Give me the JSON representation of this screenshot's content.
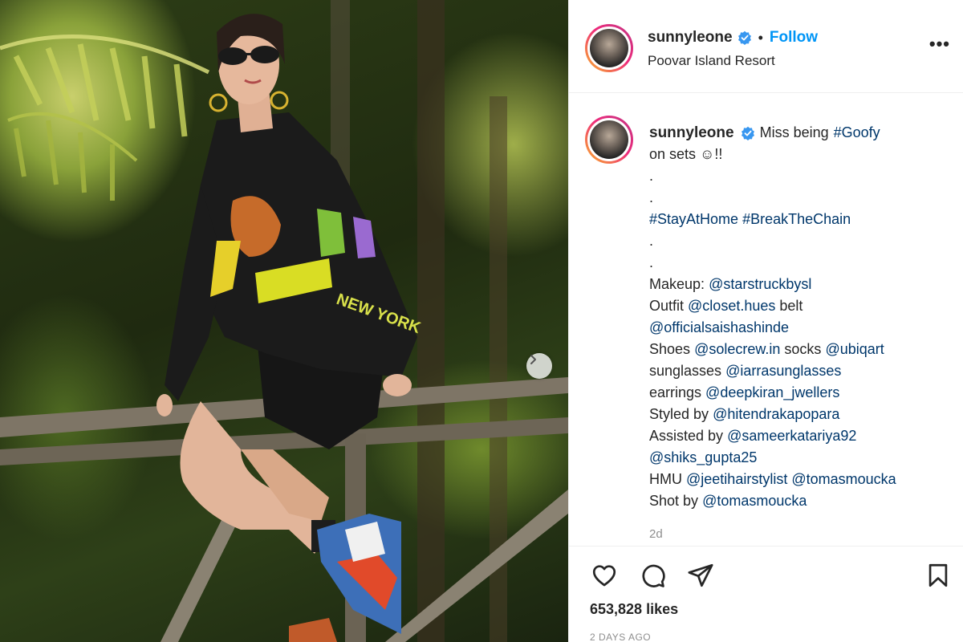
{
  "post": {
    "username": "sunnyleone",
    "follow_label": "Follow",
    "separator": "•",
    "location": "Poovar Island Resort",
    "more_label": "•••"
  },
  "caption": {
    "username": "sunnyleone",
    "text_before": "Miss being",
    "hashtag_goofy": "#Goofy",
    "text_after": "on sets ☺!!",
    "dot": ".",
    "hashtag_stay": "#StayAtHome",
    "hashtag_break": "#BreakTheChain",
    "makeup_label": "Makeup:",
    "makeup_handle": "@starstruckbysl",
    "outfit_label": "Outfit",
    "outfit_handle": "@closet.hues",
    "belt_label": "belt",
    "belt_handle": "@officialsaishashinde",
    "shoes_label": "Shoes",
    "shoes_handle": "@solecrew.in",
    "socks_label": "socks",
    "socks_handle": "@ubiqart",
    "sunglasses_label": "sunglasses",
    "sunglasses_handle": "@iarrasunglasses",
    "earrings_label": "earrings",
    "earrings_handle": "@deepkiran_jwellers",
    "styled_label": "Styled by",
    "styled_handle": "@hitendrakapopara",
    "assisted_label": "Assisted by",
    "assisted_handle": "@sameerkatariya92",
    "assisted_handle2": "@shiks_gupta25",
    "hmu_label": "HMU",
    "hmu_handle": "@jeetihairstylist",
    "hmu_handle2": "@tomasmoucka",
    "shot_label": "Shot by",
    "shot_handle": "@tomasmoucka",
    "time": "2d"
  },
  "footer": {
    "likes": "653,828 likes",
    "posted": "2 DAYS AGO"
  },
  "icons": {
    "like": "heart-icon",
    "comment": "comment-icon",
    "share": "paper-plane-icon",
    "save": "bookmark-icon",
    "verified": "verified-badge-icon",
    "next": "chevron-right-icon"
  },
  "colors": {
    "link": "#00376b",
    "follow": "#0095f6",
    "verified": "#3897f0",
    "muted": "#8e8e8e"
  }
}
